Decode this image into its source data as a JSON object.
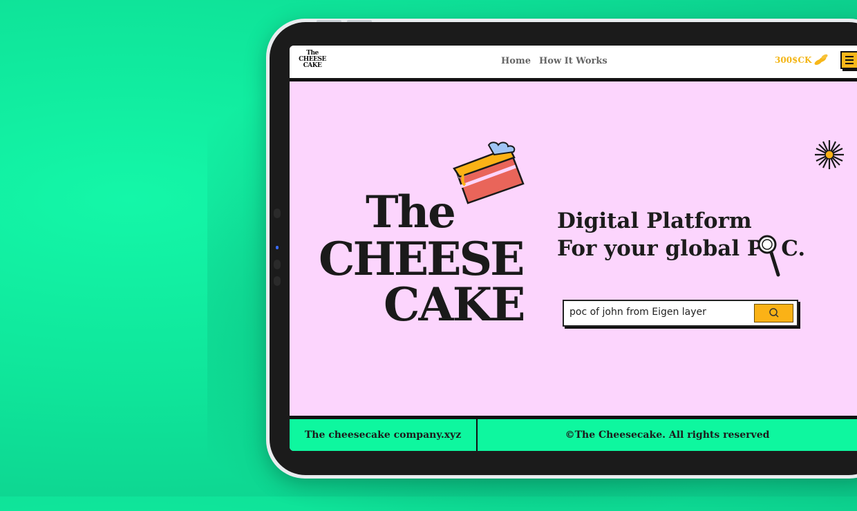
{
  "nav": {
    "logo": [
      "The",
      "CHEESE",
      "CAKE"
    ],
    "links": [
      "Home",
      "How It Works"
    ],
    "tokens": "300$CK",
    "token_icon": "coin-stack-icon",
    "menu_icon": "hamburger-menu-icon"
  },
  "hero": {
    "logo_words": [
      "The",
      "CHEESE",
      "CAKE"
    ],
    "tagline_line1": "Digital Platform",
    "tagline_line2_a": "For your global P",
    "tagline_line2_b": "C.",
    "search_value": "poc of john from Eigen layer",
    "search_icon": "search-icon"
  },
  "footer": {
    "left": "The cheesecake company.xyz",
    "right": "©The Cheesecake. All rights reserved"
  },
  "colors": {
    "background": "#0fe59a",
    "screen": "#fcd5fd",
    "accent": "#fbb216",
    "footer": "#0ef79f",
    "text": "#1c1c1c"
  }
}
